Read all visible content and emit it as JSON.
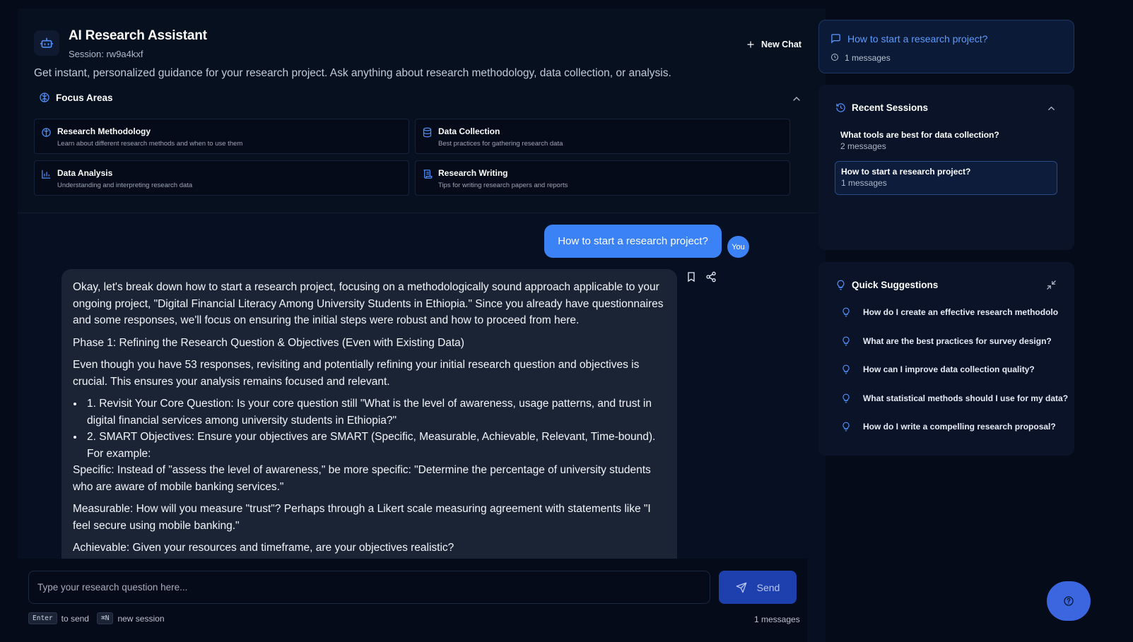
{
  "header": {
    "title": "AI Research Assistant",
    "session": "Session: rw9a4kxf",
    "new_chat": "New Chat",
    "intro": "Get instant, personalized guidance for your research project. Ask anything about research methodology, data collection, or analysis."
  },
  "focus": {
    "title": "Focus Areas",
    "cards": [
      {
        "title": "Research Methodology",
        "desc": "Learn about different research methods and when to use them",
        "icon": "brain-icon"
      },
      {
        "title": "Data Collection",
        "desc": "Best practices for gathering research data",
        "icon": "database-icon"
      },
      {
        "title": "Data Analysis",
        "desc": "Understanding and interpreting research data",
        "icon": "bar-chart-icon"
      },
      {
        "title": "Research Writing",
        "desc": "Tips for writing research papers and reports",
        "icon": "scroll-icon"
      }
    ]
  },
  "chat": {
    "user_message": "How to start a research project?",
    "user_label": "You",
    "ai": {
      "p1": "Okay, let's break down how to start a research project, focusing on a methodologically sound approach applicable to your ongoing project, \"Digital Financial Literacy Among University Students in Ethiopia.\" Since you already have questionnaires and some responses, we'll focus on ensuring the initial steps were robust and how to proceed from here.",
      "p2": "Phase 1: Refining the Research Question & Objectives (Even with Existing Data)",
      "p3": "Even though you have 53 responses, revisiting and potentially refining your initial research question and objectives is crucial. This ensures your analysis remains focused and relevant.",
      "b1": "1. Revisit Your Core Question: Is your core question still \"What is the level of awareness, usage patterns, and trust in digital financial services among university students in Ethiopia?\"",
      "b2": "2. SMART Objectives: Ensure your objectives are SMART (Specific, Measurable, Achievable, Relevant, Time-bound). For example:",
      "p4": "Specific: Instead of \"assess the level of awareness,\" be more specific: \"Determine the percentage of university students who are aware of mobile banking services.\"",
      "p5": "Measurable: How will you measure \"trust\"? Perhaps through a Likert scale measuring agreement with statements like \"I feel secure using mobile banking.\"",
      "p6": "Achievable: Given your resources and timeframe, are your objectives realistic?"
    }
  },
  "composer": {
    "placeholder": "Type your research question here...",
    "send": "Send",
    "hint_enter_key": "Enter",
    "hint_enter": "to send",
    "hint_new_key": "⌘N",
    "hint_new": "new session",
    "count": "1 messages"
  },
  "current_session": {
    "title": "How to start a research project?",
    "messages": "1 messages"
  },
  "recent": {
    "title": "Recent Sessions",
    "items": [
      {
        "title": "What tools are best for data collection?",
        "messages": "2 messages"
      },
      {
        "title": "How to start a research project?",
        "messages": "1 messages"
      }
    ]
  },
  "suggestions": {
    "title": "Quick Suggestions",
    "items": [
      "How do I create an effective research methodology?",
      "What are the best practices for survey design?",
      "How can I improve data collection quality?",
      "What statistical methods should I use for my data?",
      "How do I write a compelling research proposal?"
    ]
  },
  "colors": {
    "accent": "#3b82f6",
    "link": "#5b9bff",
    "send": "#1e40af",
    "bg": "#050b18"
  }
}
